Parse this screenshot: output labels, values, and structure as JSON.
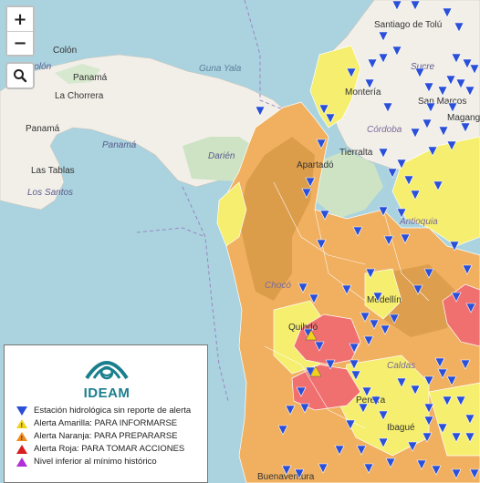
{
  "map": {
    "places": {
      "colon": "Colón",
      "colon_dept": "Colón",
      "panama_city": "Panamá",
      "la_chorrera": "La Chorrera",
      "panama_prov": "Panamá",
      "panama_prov2": "Panamá",
      "guna_yala": "Guna Yala",
      "darien": "Darién",
      "las_tablas": "Las Tablas",
      "los_santos": "Los Santos",
      "santiago_tolu": "Santiago de Tolú",
      "sucre": "Sucre",
      "san_marcos": "San Marcos",
      "monteria": "Montería",
      "magangue": "Magang",
      "cordoba": "Córdoba",
      "tierralta": "Tierralta",
      "apartado": "Apartadó",
      "choco": "Chocó",
      "antioquia": "Antioquia",
      "medellin": "Medellín",
      "quibdo": "Quibdó",
      "caldas": "Caldas",
      "pereira": "Pereira",
      "ibague": "Ibagué",
      "buenaventura": "Buenaventura"
    },
    "colors": {
      "sea": "#aad3df",
      "land_panama": "#f2efe9",
      "forest": "#cde3c4",
      "alert_yellow": "#f5ee6e",
      "alert_orange": "#f0b060",
      "alert_orange_dark": "#d89a48",
      "alert_red": "#f07070",
      "station_blue": "#2a4fd8"
    }
  },
  "controls": {
    "zoom_in": "+",
    "zoom_out": "−"
  },
  "legend": {
    "logo_text": "IDEAM",
    "items": [
      {
        "label": "Estación hidrológica sin reporte de alerta",
        "symbol": "blue-triangle",
        "color": "#2a4fd8"
      },
      {
        "label": "Alerta Amarilla: PARA INFORMARSE",
        "symbol": "yellow-triangle",
        "color": "#f2d21a"
      },
      {
        "label": "Alerta Naranja: PARA PREPARARSE",
        "symbol": "orange-triangle",
        "color": "#f08a1a"
      },
      {
        "label": "Alerta Roja: PARA TOMAR ACCIONES",
        "symbol": "red-triangle",
        "color": "#d81e1e"
      },
      {
        "label": "Nivel inferior al mínimo histórico",
        "symbol": "purple-triangle",
        "color": "#b030d8"
      }
    ]
  }
}
